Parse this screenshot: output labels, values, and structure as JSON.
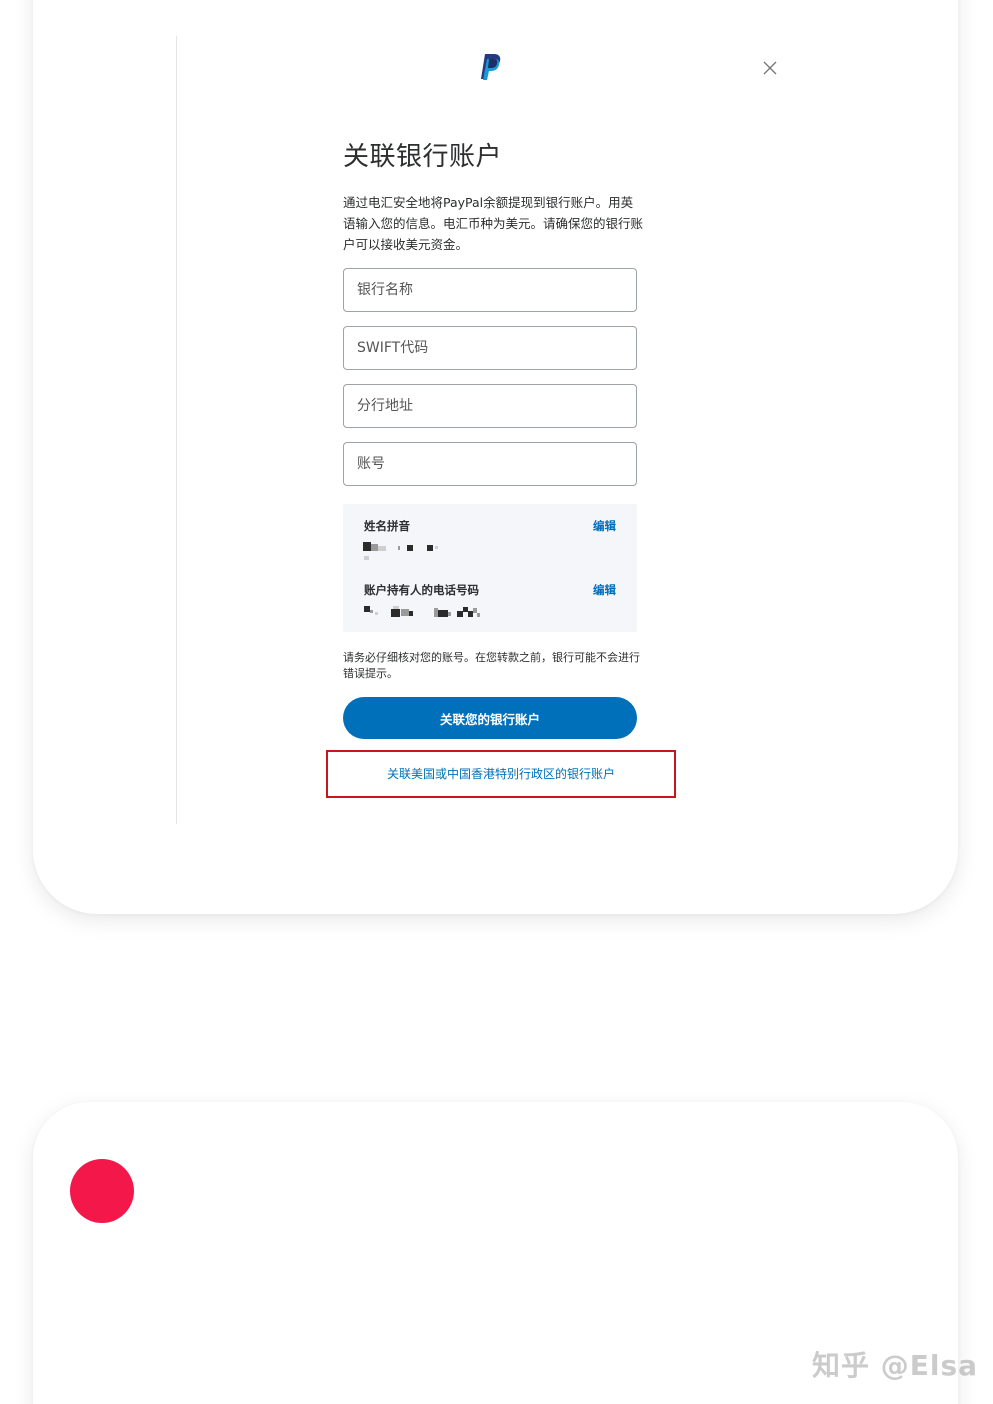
{
  "dialog": {
    "title": "关联银行账户",
    "description": "通过电汇安全地将PayPal余额提现到银行账户。用英语输入您的信息。电汇币种为美元。请确保您的银行账户可以接收美元资金。",
    "close_icon": "close-icon",
    "logo_icon": "paypal-logo-icon"
  },
  "fields": {
    "bank_name": {
      "placeholder": "银行名称",
      "value": ""
    },
    "swift_code": {
      "placeholder": "SWIFT代码",
      "value": ""
    },
    "branch_address": {
      "placeholder": "分行地址",
      "value": ""
    },
    "account_number": {
      "placeholder": "账号",
      "value": ""
    }
  },
  "info": {
    "name_label": "姓名拼音",
    "name_edit": "编辑",
    "phone_label": "账户持有人的电话号码",
    "phone_edit": "编辑"
  },
  "warning": "请务必仔细核对您的账号。在您转款之前，银行可能不会进行错误提示。",
  "primary_button": "关联您的银行账户",
  "alt_link": "关联美国或中国香港特别行政区的银行账户",
  "watermark": "知乎 @Elsa",
  "colors": {
    "accent": "#0070ba",
    "highlight": "#c8161d",
    "dot": "#f3174a"
  }
}
